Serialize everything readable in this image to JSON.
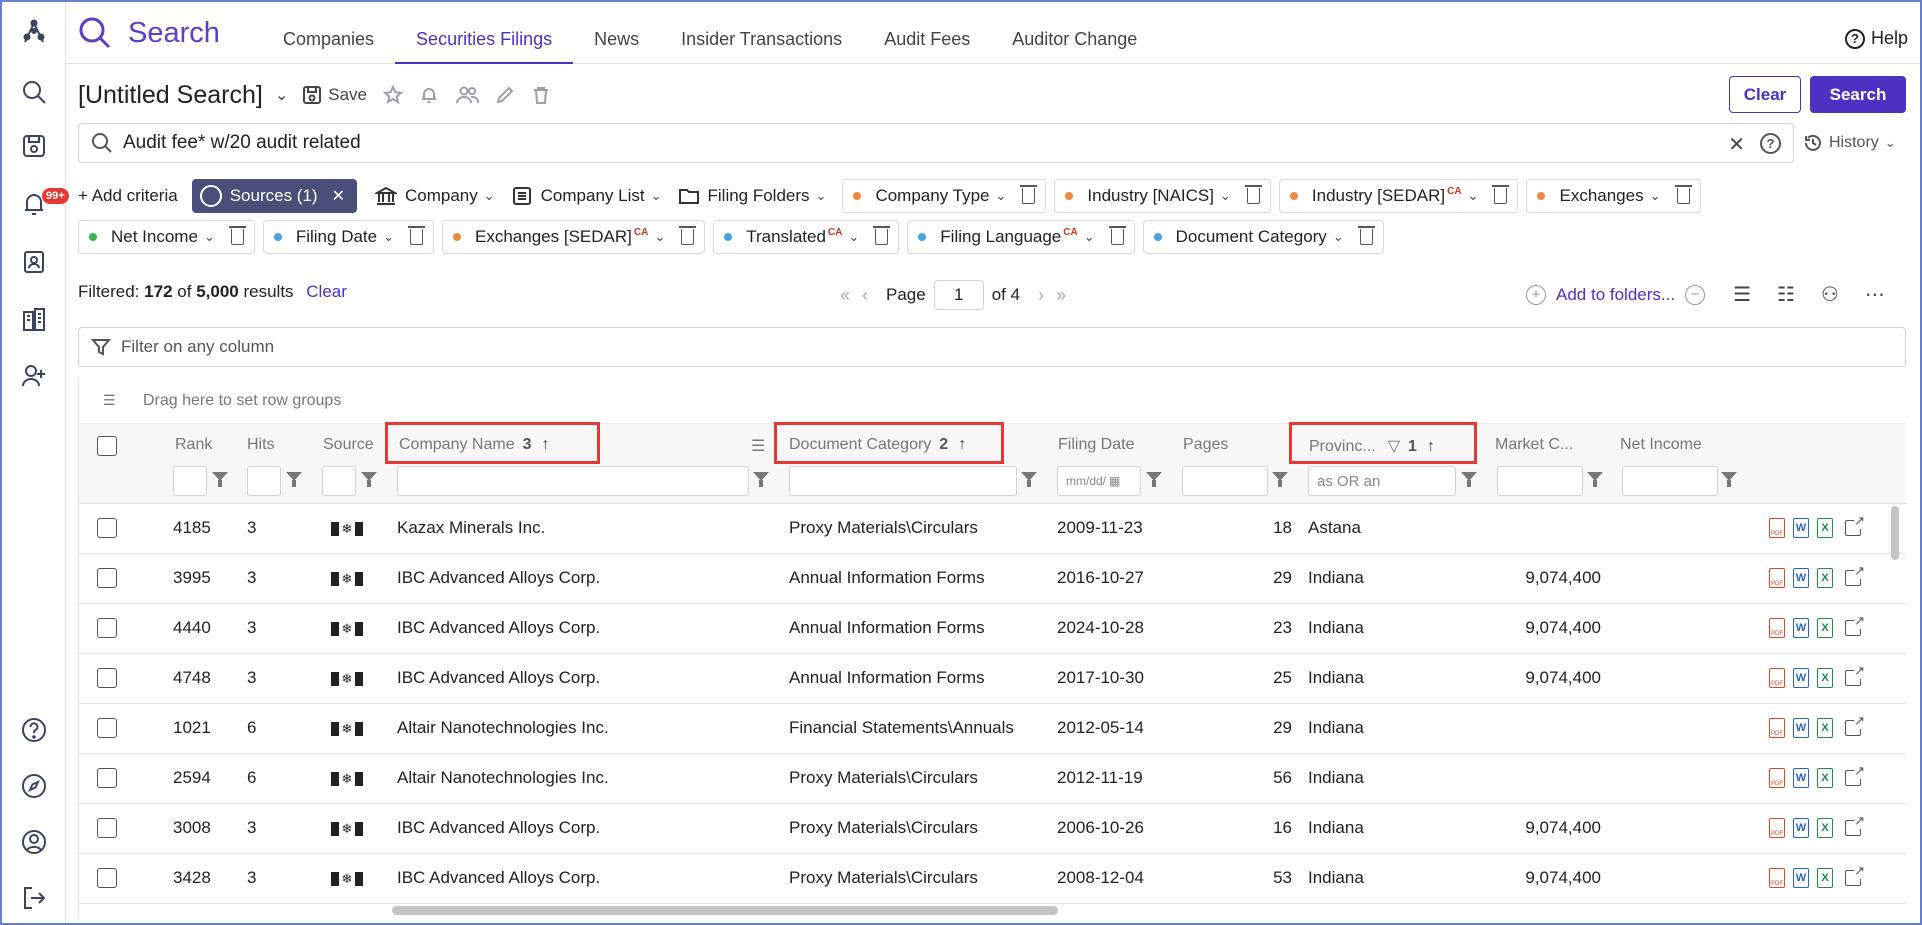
{
  "nav": {
    "brand": "Search",
    "tabs": [
      "Companies",
      "Securities Filings",
      "News",
      "Insider Transactions",
      "Audit Fees",
      "Auditor Change"
    ],
    "active_tab": "Securities Filings",
    "help": "Help",
    "notification_badge": "99+"
  },
  "search": {
    "title": "[Untitled Search]",
    "save_label": "Save",
    "query": "Audit fee* w/20 audit related",
    "clear_label": "Clear",
    "search_label": "Search",
    "history_label": "History"
  },
  "criteria": {
    "add_label": "+ Add criteria",
    "sources_label": "Sources (1)",
    "plain": [
      "Company",
      "Company List",
      "Filing Folders"
    ],
    "chips_row1": [
      {
        "label": "Company Type",
        "color": "#f0883e",
        "ca": ""
      },
      {
        "label": "Industry [NAICS]",
        "color": "#f0883e",
        "ca": ""
      },
      {
        "label": "Industry [SEDAR]",
        "color": "#f0883e",
        "ca": "CA"
      },
      {
        "label": "Exchanges",
        "color": "#f0883e",
        "ca": ""
      }
    ],
    "chips_row2": [
      {
        "label": "Net Income",
        "color": "#3cb44b",
        "ca": ""
      },
      {
        "label": "Filing Date",
        "color": "#4aa3df",
        "ca": ""
      },
      {
        "label": "Exchanges [SEDAR]",
        "color": "#f0883e",
        "ca": "CA"
      },
      {
        "label": "Translated",
        "color": "#4aa3df",
        "ca": "CA"
      },
      {
        "label": "Filing Language",
        "color": "#4aa3df",
        "ca": "CA"
      },
      {
        "label": "Document Category",
        "color": "#4aa3df",
        "ca": ""
      }
    ]
  },
  "results": {
    "prefix": "Filtered:",
    "filtered": "172",
    "of": "of",
    "total": "5,000",
    "suffix": "results",
    "clear": "Clear",
    "page_label": "Page",
    "page": "1",
    "page_total": "of 4",
    "add_to_folders": "Add to folders..."
  },
  "grid": {
    "filter_placeholder": "Filter on any column",
    "group_hint": "Drag here to set row groups",
    "columns": {
      "rank": "Rank",
      "hits": "Hits",
      "source": "Source",
      "company": "Company Name",
      "company_sort": "3",
      "category": "Document Category",
      "category_sort": "2",
      "filing_date": "Filing Date",
      "pages": "Pages",
      "province": "Provinc...",
      "province_sort": "1",
      "market_cap": "Market C...",
      "net_income": "Net Income"
    },
    "date_placeholder": "mm/dd/",
    "province_placeholder": "as OR an",
    "rows": [
      {
        "rank": "4185",
        "hits": "3",
        "company": "Kazax Minerals Inc.",
        "category": "Proxy Materials\\Circulars",
        "date": "2009-11-23",
        "pages": "18",
        "province": "Astana",
        "market_cap": ""
      },
      {
        "rank": "3995",
        "hits": "3",
        "company": "IBC Advanced Alloys Corp.",
        "category": "Annual Information Forms",
        "date": "2016-10-27",
        "pages": "29",
        "province": "Indiana",
        "market_cap": "9,074,400"
      },
      {
        "rank": "4440",
        "hits": "3",
        "company": "IBC Advanced Alloys Corp.",
        "category": "Annual Information Forms",
        "date": "2024-10-28",
        "pages": "23",
        "province": "Indiana",
        "market_cap": "9,074,400"
      },
      {
        "rank": "4748",
        "hits": "3",
        "company": "IBC Advanced Alloys Corp.",
        "category": "Annual Information Forms",
        "date": "2017-10-30",
        "pages": "25",
        "province": "Indiana",
        "market_cap": "9,074,400"
      },
      {
        "rank": "1021",
        "hits": "6",
        "company": "Altair Nanotechnologies Inc.",
        "category": "Financial Statements\\Annuals",
        "date": "2012-05-14",
        "pages": "29",
        "province": "Indiana",
        "market_cap": ""
      },
      {
        "rank": "2594",
        "hits": "6",
        "company": "Altair Nanotechnologies Inc.",
        "category": "Proxy Materials\\Circulars",
        "date": "2012-11-19",
        "pages": "56",
        "province": "Indiana",
        "market_cap": ""
      },
      {
        "rank": "3008",
        "hits": "3",
        "company": "IBC Advanced Alloys Corp.",
        "category": "Proxy Materials\\Circulars",
        "date": "2006-10-26",
        "pages": "16",
        "province": "Indiana",
        "market_cap": "9,074,400"
      },
      {
        "rank": "3428",
        "hits": "3",
        "company": "IBC Advanced Alloys Corp.",
        "category": "Proxy Materials\\Circulars",
        "date": "2008-12-04",
        "pages": "53",
        "province": "Indiana",
        "market_cap": "9,074,400"
      }
    ]
  }
}
